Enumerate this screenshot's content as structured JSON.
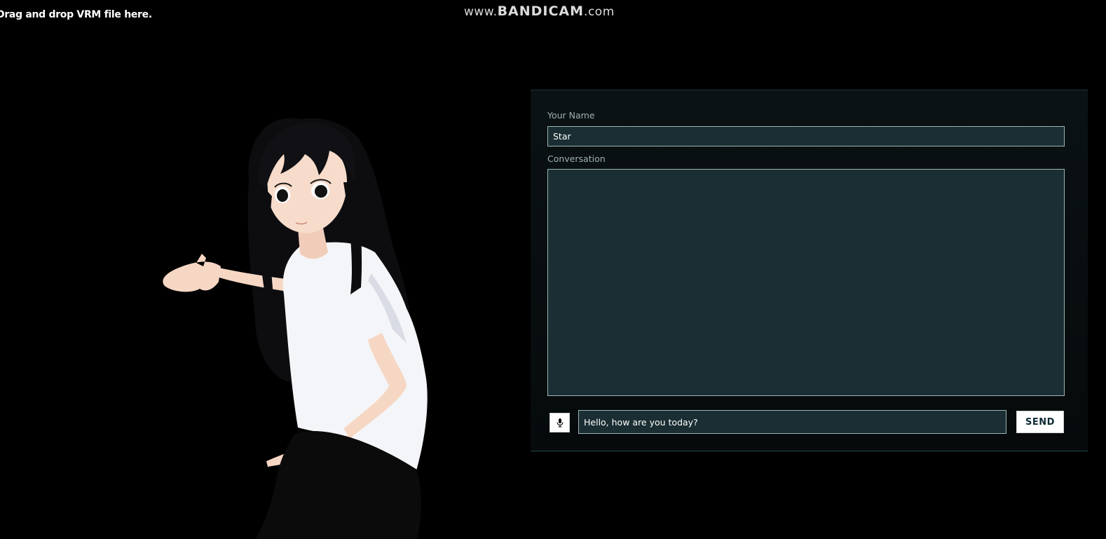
{
  "header": {
    "drop_hint": "Drag and drop VRM file here.",
    "watermark_prefix": "www.",
    "watermark_brand": "BANDICAM",
    "watermark_suffix": ".com"
  },
  "chat": {
    "name_label": "Your Name",
    "name_value": "Star",
    "conversation_label": "Conversation",
    "conversation_text": "",
    "message_value": "Hello, how are you today?",
    "send_label": "SEND",
    "mic_icon": "microphone-icon"
  },
  "colors": {
    "background": "#000000",
    "field_background": "#1a2e33",
    "field_border": "#9bb5b3",
    "label_text": "#9fb0b0",
    "send_text": "#0d2a35"
  }
}
